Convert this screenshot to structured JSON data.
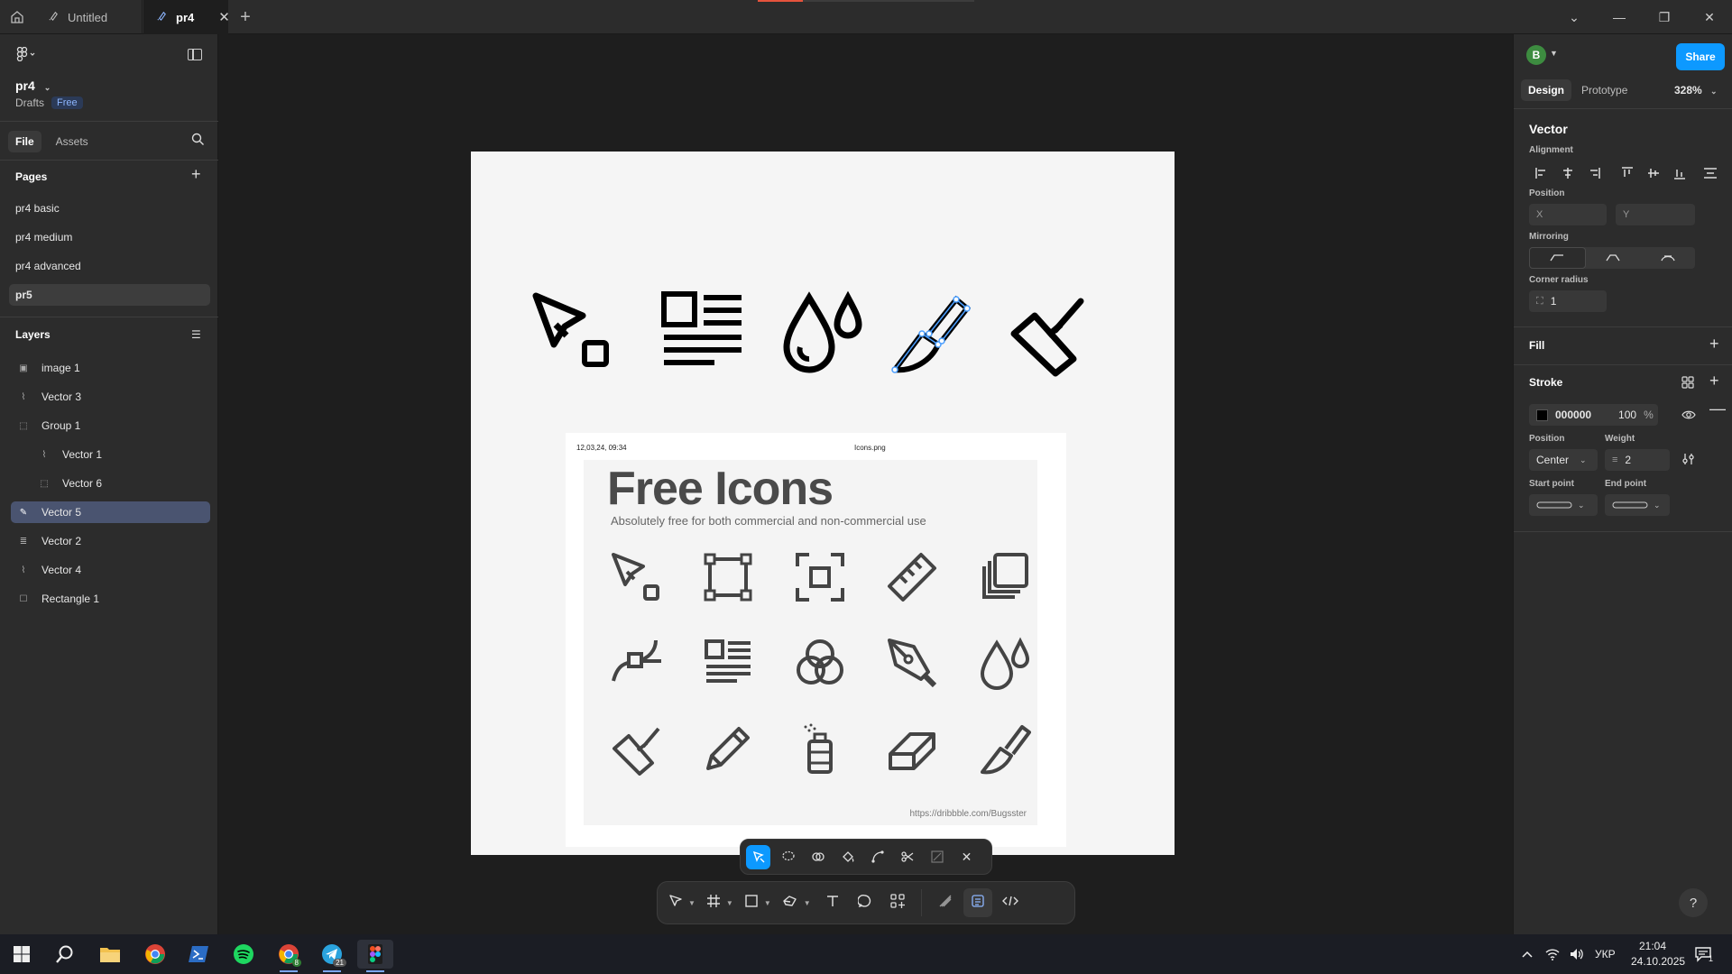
{
  "titlebar": {
    "tabs": [
      {
        "label": "Untitled",
        "icon": "figma-file-icon"
      },
      {
        "label": "pr4",
        "icon": "figma-file-icon"
      }
    ]
  },
  "left_panel": {
    "file_name": "pr4",
    "location": "Drafts",
    "plan_badge": "Free",
    "tabs": [
      "File",
      "Assets"
    ],
    "pages_title": "Pages",
    "pages": [
      "pr4 basic",
      "pr4 medium",
      "pr4 advanced",
      "pr5"
    ],
    "active_page": "pr5",
    "layers_title": "Layers",
    "layers": [
      {
        "name": "image 1",
        "icon": "image-icon",
        "indent": false,
        "active": false
      },
      {
        "name": "Vector 3",
        "icon": "vector-icon",
        "indent": false,
        "active": false
      },
      {
        "name": "Group 1",
        "icon": "group-icon",
        "indent": false,
        "active": false
      },
      {
        "name": "Vector 1",
        "icon": "vector-icon",
        "indent": true,
        "active": false
      },
      {
        "name": "Vector 6",
        "icon": "vector-icon",
        "indent": true,
        "active": false
      },
      {
        "name": "Vector 5",
        "icon": "pen-icon",
        "indent": false,
        "active": true
      },
      {
        "name": "Vector 2",
        "icon": "vector-icon",
        "indent": false,
        "active": false
      },
      {
        "name": "Vector 4",
        "icon": "vector-icon",
        "indent": false,
        "active": false
      },
      {
        "name": "Rectangle 1",
        "icon": "rectangle-icon",
        "indent": false,
        "active": false
      }
    ]
  },
  "right_panel": {
    "avatar_letter": "B",
    "share_label": "Share",
    "tabs": [
      "Design",
      "Prototype"
    ],
    "zoom": "328%",
    "selection_title": "Vector",
    "alignment_label": "Alignment",
    "position_label": "Position",
    "x_label": "X",
    "y_label": "Y",
    "mirroring_label": "Mirroring",
    "corner_radius_label": "Corner radius",
    "corner_radius_value": "1",
    "fill_label": "Fill",
    "stroke_label": "Stroke",
    "stroke_color": "000000",
    "stroke_opacity": "100",
    "stroke_opacity_unit": "%",
    "stroke_position_label": "Position",
    "stroke_position_value": "Center",
    "weight_label": "Weight",
    "weight_value": "2",
    "start_point_label": "Start point",
    "end_point_label": "End point"
  },
  "canvas": {
    "image_meta_left": "12,03,24, 09:34",
    "image_meta_center": "Icons.png",
    "image_title": "Free Icons",
    "image_subtitle": "Absolutely free for both commercial and non-commercial use",
    "image_url": "https://dribbble.com/Bugsster"
  },
  "taskbar": {
    "language": "УКР",
    "time": "21:04",
    "date": "24.10.2025",
    "notification_count": "1",
    "chrome_badge": "8",
    "telegram_badge": "21"
  },
  "colors": {
    "accent": "#0d99ff",
    "selection_row": "#4a5470",
    "panel_bg": "#2c2c2c",
    "canvas_bg": "#1e1e1e"
  }
}
